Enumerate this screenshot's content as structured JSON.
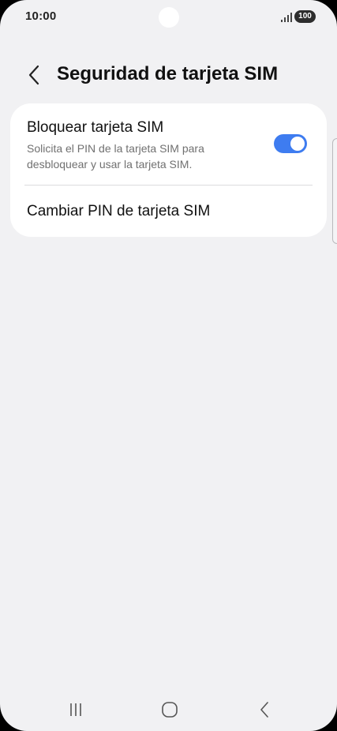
{
  "status_bar": {
    "time": "10:00",
    "battery": "100",
    "signal_icon": "signal-bars-icon"
  },
  "header": {
    "back_icon": "chevron-left-icon",
    "title": "Seguridad de tarjeta SIM"
  },
  "settings": {
    "lock_sim": {
      "title": "Bloquear tarjeta SIM",
      "description": "Solicita el PIN de la tarjeta SIM para desbloquear y usar la tarjeta SIM.",
      "enabled": true
    },
    "change_pin": {
      "label": "Cambiar PIN de tarjeta SIM"
    }
  },
  "nav_bar": {
    "recents_icon": "recents-icon",
    "home_icon": "home-icon",
    "back_icon": "back-icon"
  },
  "colors": {
    "accent": "#3e7cf0",
    "background": "#f1f1f3",
    "card": "#ffffff"
  }
}
